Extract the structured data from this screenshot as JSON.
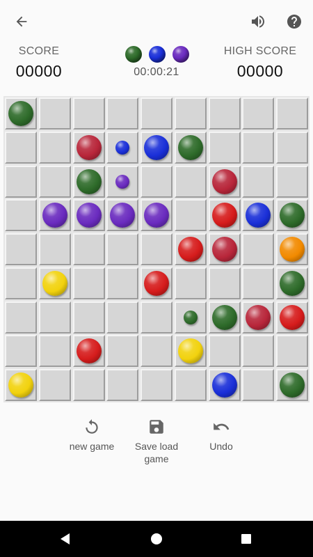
{
  "header": {
    "back_icon": "arrow-left-icon",
    "sound_icon": "volume-icon",
    "help_icon": "help-circle-icon"
  },
  "score": {
    "label": "SCORE",
    "value": "00000"
  },
  "high_score": {
    "label": "HIGH SCORE",
    "value": "00000"
  },
  "next_balls": [
    "green",
    "blue",
    "purple"
  ],
  "timer": "00:00:21",
  "colors": {
    "green": "#2e6b2a",
    "blue": "#1a2fd8",
    "purple": "#6a2bbf",
    "red": "#d61c1c",
    "dark_red": "#b8263a",
    "yellow": "#f2d20e",
    "orange": "#f28a00"
  },
  "board": {
    "rows": 9,
    "cols": 9,
    "balls": [
      {
        "row": 0,
        "col": 0,
        "color": "green",
        "size": "large"
      },
      {
        "row": 1,
        "col": 2,
        "color": "dark_red",
        "size": "large"
      },
      {
        "row": 1,
        "col": 3,
        "color": "blue",
        "size": "small"
      },
      {
        "row": 1,
        "col": 4,
        "color": "blue",
        "size": "large"
      },
      {
        "row": 1,
        "col": 5,
        "color": "green",
        "size": "large"
      },
      {
        "row": 2,
        "col": 2,
        "color": "green",
        "size": "large"
      },
      {
        "row": 2,
        "col": 3,
        "color": "purple",
        "size": "small"
      },
      {
        "row": 2,
        "col": 6,
        "color": "dark_red",
        "size": "large"
      },
      {
        "row": 3,
        "col": 1,
        "color": "purple",
        "size": "large"
      },
      {
        "row": 3,
        "col": 2,
        "color": "purple",
        "size": "large"
      },
      {
        "row": 3,
        "col": 3,
        "color": "purple",
        "size": "large"
      },
      {
        "row": 3,
        "col": 4,
        "color": "purple",
        "size": "large"
      },
      {
        "row": 3,
        "col": 6,
        "color": "red",
        "size": "large"
      },
      {
        "row": 3,
        "col": 7,
        "color": "blue",
        "size": "large"
      },
      {
        "row": 3,
        "col": 8,
        "color": "green",
        "size": "large"
      },
      {
        "row": 4,
        "col": 5,
        "color": "red",
        "size": "large"
      },
      {
        "row": 4,
        "col": 6,
        "color": "dark_red",
        "size": "large"
      },
      {
        "row": 4,
        "col": 8,
        "color": "orange",
        "size": "large"
      },
      {
        "row": 5,
        "col": 1,
        "color": "yellow",
        "size": "large"
      },
      {
        "row": 5,
        "col": 4,
        "color": "red",
        "size": "large"
      },
      {
        "row": 5,
        "col": 8,
        "color": "green",
        "size": "large"
      },
      {
        "row": 6,
        "col": 5,
        "color": "green",
        "size": "small"
      },
      {
        "row": 6,
        "col": 6,
        "color": "green",
        "size": "large"
      },
      {
        "row": 6,
        "col": 7,
        "color": "dark_red",
        "size": "large"
      },
      {
        "row": 6,
        "col": 8,
        "color": "red",
        "size": "large"
      },
      {
        "row": 7,
        "col": 2,
        "color": "red",
        "size": "large"
      },
      {
        "row": 7,
        "col": 5,
        "color": "yellow",
        "size": "large"
      },
      {
        "row": 8,
        "col": 0,
        "color": "yellow",
        "size": "large"
      },
      {
        "row": 8,
        "col": 6,
        "color": "blue",
        "size": "large"
      },
      {
        "row": 8,
        "col": 8,
        "color": "green",
        "size": "large"
      }
    ]
  },
  "actions": {
    "new_game": {
      "label": "new game",
      "icon": "refresh-icon"
    },
    "save_load": {
      "label": "Save load game",
      "icon": "save-icon"
    },
    "undo": {
      "label": "Undo",
      "icon": "undo-icon"
    }
  },
  "navbar": {
    "back_icon": "nav-back-triangle-icon",
    "home_icon": "nav-home-circle-icon",
    "recent_icon": "nav-recent-square-icon"
  }
}
